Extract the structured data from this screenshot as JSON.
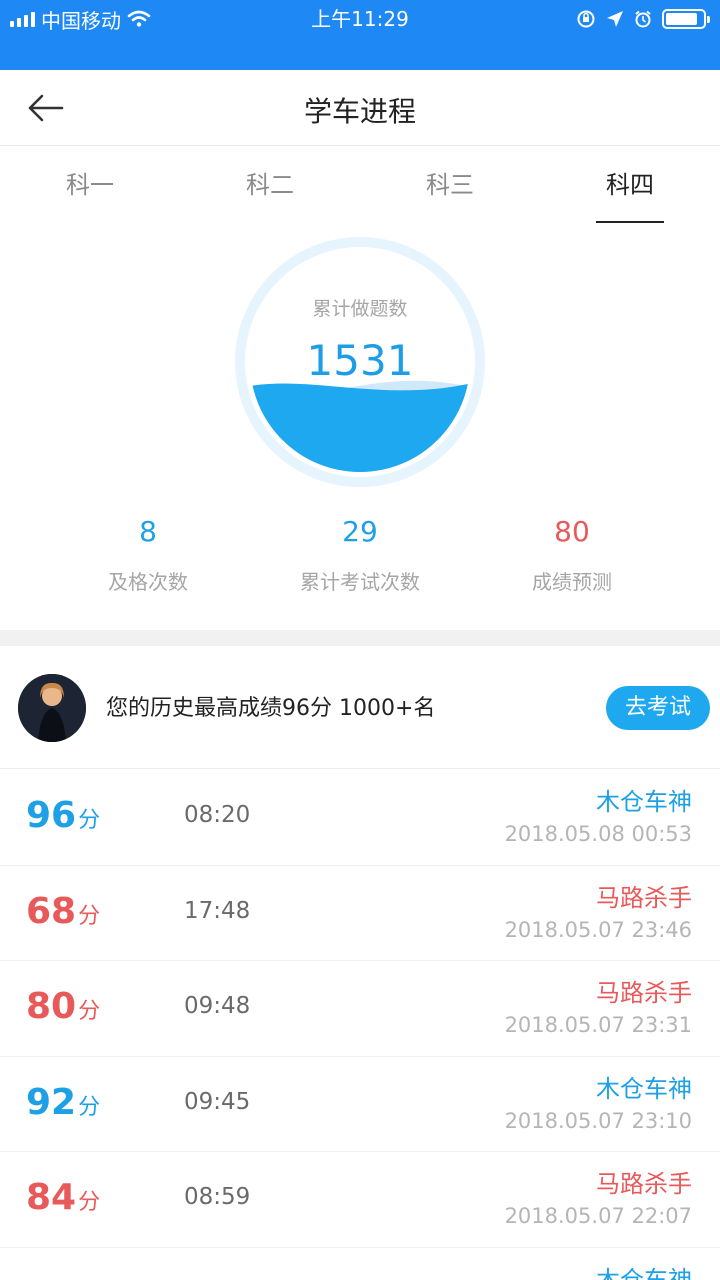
{
  "status": {
    "carrier": "中国移动",
    "time": "上午11:29",
    "battery_level": 0.85,
    "icons": [
      "signal-icon",
      "wifi-icon",
      "orientation-lock-icon",
      "location-icon",
      "alarm-icon",
      "battery-icon"
    ]
  },
  "nav": {
    "title": "学车进程",
    "back_icon": "arrow-left-icon"
  },
  "tabs": [
    {
      "label": "科一"
    },
    {
      "label": "科二"
    },
    {
      "label": "科三"
    },
    {
      "label": "科四",
      "active": true
    }
  ],
  "gauge": {
    "label": "累计做题数",
    "value": "1531",
    "fill_fraction": 0.42
  },
  "stats": [
    {
      "value": "8",
      "label": "及格次数",
      "color": "#1ea0e6"
    },
    {
      "value": "29",
      "label": "累计考试次数",
      "color": "#1ea0e6"
    },
    {
      "value": "80",
      "label": "成绩预测",
      "color": "#e85a5a"
    }
  ],
  "best": {
    "text": "您的历史最高成绩96分 1000+名",
    "button": "去考试"
  },
  "records": [
    {
      "score": "96",
      "unit": "分",
      "duration": "08:20",
      "title": "木仓车神",
      "date": "2018.05.08 00:53",
      "color": "blue"
    },
    {
      "score": "68",
      "unit": "分",
      "duration": "17:48",
      "title": "马路杀手",
      "date": "2018.05.07 23:46",
      "color": "red"
    },
    {
      "score": "80",
      "unit": "分",
      "duration": "09:48",
      "title": "马路杀手",
      "date": "2018.05.07 23:31",
      "color": "red"
    },
    {
      "score": "92",
      "unit": "分",
      "duration": "09:45",
      "title": "木仓车神",
      "date": "2018.05.07 23:10",
      "color": "blue"
    },
    {
      "score": "84",
      "unit": "分",
      "duration": "08:59",
      "title": "马路杀手",
      "date": "2018.05.07 22:07",
      "color": "red"
    },
    {
      "title": "木仓车神",
      "color": "blue"
    }
  ],
  "colors": {
    "status_bar": "#1e88f5",
    "blue": "#1ea0e6",
    "red": "#e85a5a",
    "wave": "#1ea8ef"
  }
}
